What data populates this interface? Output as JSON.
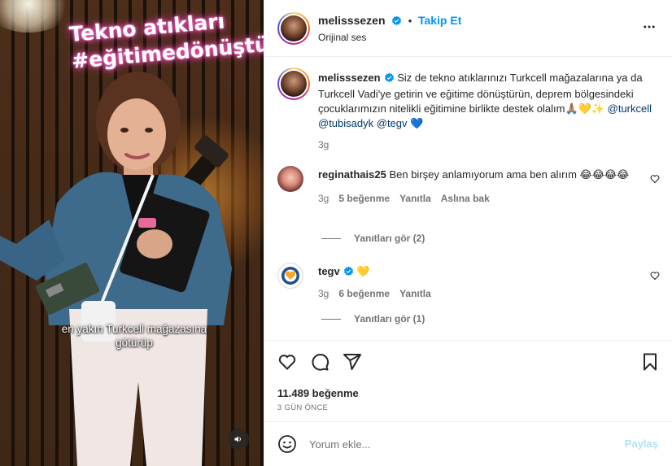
{
  "media": {
    "neon_line1": "Tekno atıkları",
    "neon_line2": "#eğitimedönüştür",
    "caption_line1": "en yakın Turkcell mağazasına",
    "caption_line2": "götürüp",
    "sound_icon": "speaker-icon"
  },
  "header": {
    "username": "melisssezen",
    "dot": "•",
    "follow_label": "Takip Et",
    "audio_label": "Orijinal ses",
    "more_icon": "more-horizontal-icon"
  },
  "caption_post": {
    "username": "melisssezen",
    "text": "Siz de tekno atıklarınızı Turkcell mağazalarına ya da Turkcell Vadi'ye getirin ve eğitime dönüştürün, deprem bölgesindeki çocuklarımızın nitelikli eğitimine birlikte destek olalım🙏🏽💛✨",
    "mention1": "@turkcell",
    "mention2": "@tubisadyk",
    "mention3": "@tegv",
    "emoji_end": "💙",
    "time": "3g"
  },
  "comments": [
    {
      "username": "reginathais25",
      "text": "Ben birşey anlamıyorum ama ben alırım 😂😂😂😂",
      "time": "3g",
      "likes": "5 beğenme",
      "reply": "Yanıtla",
      "translate": "Aslına bak",
      "view_replies": "Yanıtları gör (2)"
    },
    {
      "username": "tegv",
      "text": "💛",
      "time": "3g",
      "likes": "6 beğenme",
      "reply": "Yanıtla",
      "view_replies": "Yanıtları gör (1)"
    }
  ],
  "actions": {
    "like_count": "11.489 beğenme",
    "date": "3 GÜN ÖNCE"
  },
  "composer": {
    "placeholder": "Yorum ekle...",
    "post_label": "Paylaş"
  },
  "colors": {
    "accent": "#0095f6",
    "verified": "#0095f6",
    "muted": "#737373",
    "post_disabled": "#b2dffc"
  }
}
